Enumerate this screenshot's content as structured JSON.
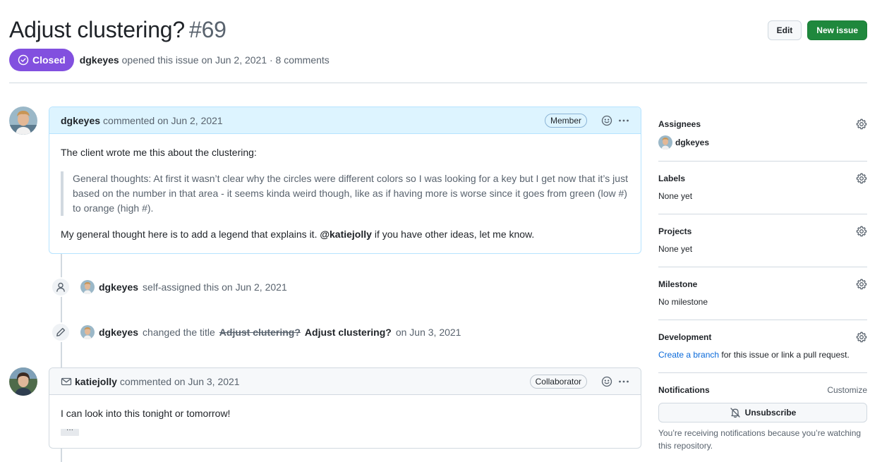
{
  "issue": {
    "title": "Adjust clustering?",
    "number": "#69",
    "state": "Closed",
    "author": "dgkeyes",
    "opened_text": "opened this issue on Jun 2, 2021 · 8 comments"
  },
  "actions": {
    "edit_label": "Edit",
    "new_issue_label": "New issue"
  },
  "comments": [
    {
      "author": "dgkeyes",
      "action": "commented on Jun 2, 2021",
      "role": "Member",
      "intro": "The client wrote me this about the clustering:",
      "quote": "General thoughts: At first it wasn’t clear why the circles were different colors so I was looking for a key but I get now that it’s just based on the number in that area - it seems kinda weird though, like as if having more is worse since it goes from green (low #) to orange (high #).",
      "closing_before": "My general thought here is to add a legend that explains it.",
      "mention": "@katiejolly",
      "closing_after": "if you have other ideas, let me know."
    },
    {
      "author": "katiejolly",
      "action": "commented on Jun 3, 2021",
      "role": "Collaborator",
      "body": "I can look into this tonight or tomorrow!",
      "more": "···"
    }
  ],
  "events": [
    {
      "actor": "dgkeyes",
      "text": "self-assigned this on Jun 2, 2021"
    },
    {
      "actor": "dgkeyes",
      "text_prefix": "changed the title",
      "old_title": "Adjust clutering?",
      "new_title": "Adjust clustering?",
      "text_suffix": "on Jun 3, 2021"
    }
  ],
  "sidebar": {
    "assignees": {
      "title": "Assignees",
      "value": "dgkeyes"
    },
    "labels": {
      "title": "Labels",
      "value": "None yet"
    },
    "projects": {
      "title": "Projects",
      "value": "None yet"
    },
    "milestone": {
      "title": "Milestone",
      "value": "No milestone"
    },
    "development": {
      "title": "Development",
      "link": "Create a branch",
      "text": "for this issue or link a pull request."
    },
    "notifications": {
      "title": "Notifications",
      "customize": "Customize",
      "unsubscribe": "Unsubscribe",
      "note": "You’re receiving notifications because you’re watching this repository."
    }
  },
  "colors": {
    "closed_badge": "#8250df",
    "primary_button": "#1f883d",
    "link": "#0969da",
    "author_header": "#ddf4ff"
  }
}
